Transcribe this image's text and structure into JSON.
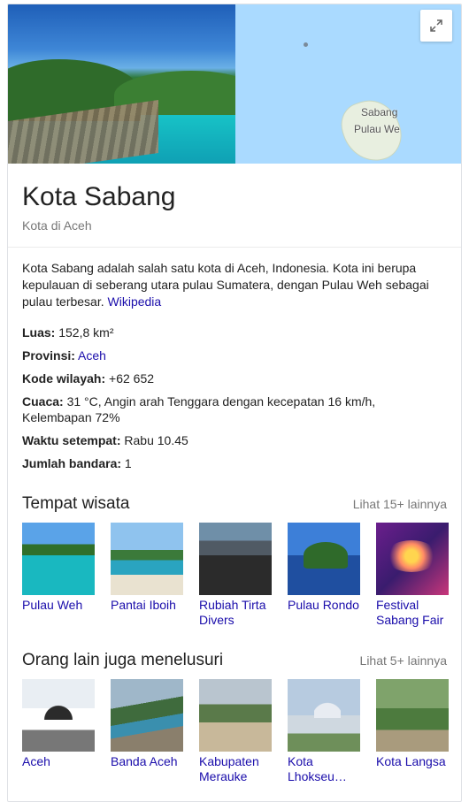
{
  "hero": {
    "map_labels": [
      "Sabang",
      "Pulau We"
    ],
    "expand_icon": "expand-icon"
  },
  "entity": {
    "title": "Kota Sabang",
    "subtitle": "Kota di Aceh"
  },
  "description": {
    "text": "Kota Sabang adalah salah satu kota di Aceh, Indonesia. Kota ini berupa kepulauan di seberang utara pulau Sumatera, dengan Pulau Weh sebagai pulau terbesar. ",
    "source_link": "Wikipedia"
  },
  "facts": [
    {
      "label": "Luas:",
      "value": " 152,8 km²"
    },
    {
      "label": "Provinsi:",
      "value": " ",
      "link": "Aceh"
    },
    {
      "label": "Kode wilayah:",
      "value": " +62 652"
    },
    {
      "label": "Cuaca:",
      "value": " 31 °C, Angin arah Tenggara dengan kecepatan 16 km/h, Kelembapan 72%"
    },
    {
      "label": "Waktu setempat:",
      "value": " Rabu 10.45"
    },
    {
      "label": "Jumlah bandara:",
      "value": " 1"
    }
  ],
  "attractions": {
    "title": "Tempat wisata",
    "more": "Lihat 15+ lainnya",
    "items": [
      {
        "label": "Pulau Weh"
      },
      {
        "label": "Pantai Iboih"
      },
      {
        "label": "Rubiah Tirta Divers"
      },
      {
        "label": "Pulau Rondo"
      },
      {
        "label": "Festival Sabang Fair"
      }
    ]
  },
  "related": {
    "title": "Orang lain juga menelusuri",
    "more": "Lihat 5+ lainnya",
    "items": [
      {
        "label": "Aceh"
      },
      {
        "label": "Banda Aceh"
      },
      {
        "label": "Kabupaten Merauke"
      },
      {
        "label": "Kota Lhokseu…"
      },
      {
        "label": "Kota Langsa"
      }
    ]
  },
  "colors": {
    "link": "#1a0dab",
    "muted": "#777777",
    "map_water": "#aadaff"
  }
}
